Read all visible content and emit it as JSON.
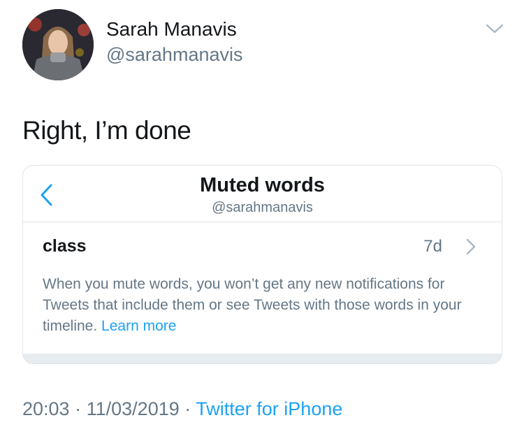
{
  "tweet": {
    "author": {
      "name": "Sarah Manavis",
      "handle": "@sarahmanavis"
    },
    "text": "Right, I’m done",
    "time": "20:03",
    "date": "11/03/2019",
    "separator": "·",
    "source": "Twitter for iPhone"
  },
  "screenshot": {
    "title": "Muted words",
    "subtitle": "@sarahmanavis",
    "muted_word": "class",
    "muted_age": "7d",
    "info": "When you mute words, you won’t get any new notifications for Tweets that include them or see Tweets with those words in your timeline.",
    "learn_more": "Learn more"
  },
  "icons": {
    "menu": "chevron-down-icon",
    "back": "back-arrow-icon",
    "row": "chevron-right-icon"
  },
  "colors": {
    "primary_text": "#14171a",
    "secondary_text": "#657786",
    "link": "#1da1f2",
    "divider": "#dfe3e8"
  }
}
